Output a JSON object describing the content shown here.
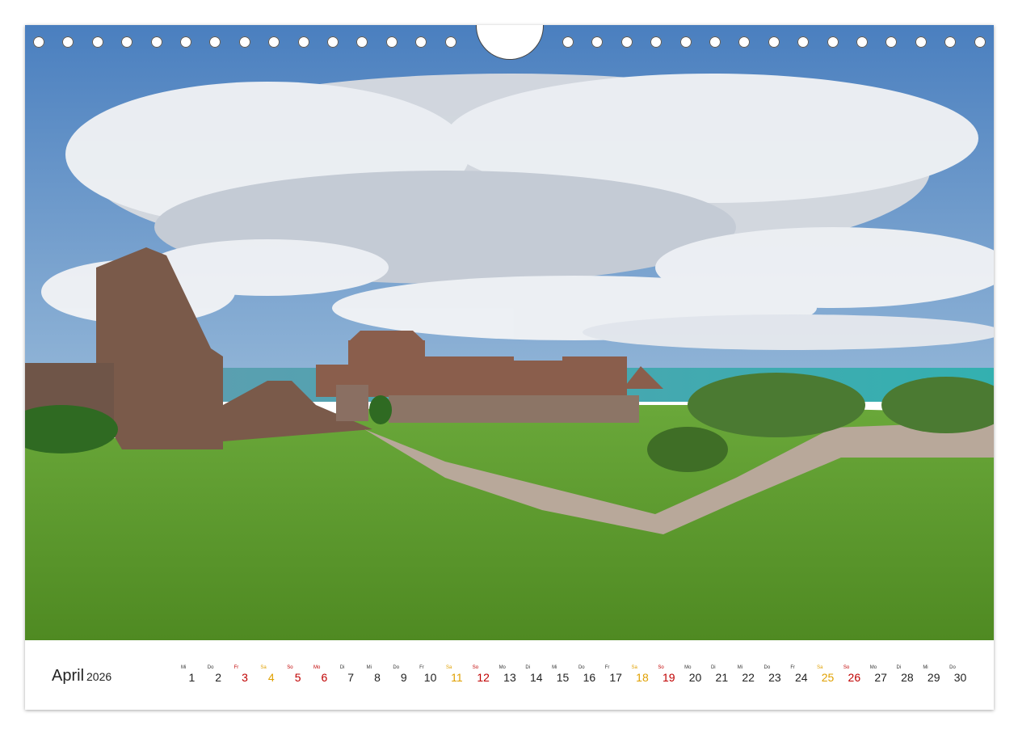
{
  "calendar": {
    "month": "April",
    "year": "2026",
    "days": [
      {
        "d": "1",
        "w": "Mi",
        "t": ""
      },
      {
        "d": "2",
        "w": "Do",
        "t": ""
      },
      {
        "d": "3",
        "w": "Fr",
        "t": "hol"
      },
      {
        "d": "4",
        "w": "Sa",
        "t": "sat"
      },
      {
        "d": "5",
        "w": "So",
        "t": "sun"
      },
      {
        "d": "6",
        "w": "Mo",
        "t": "hol"
      },
      {
        "d": "7",
        "w": "Di",
        "t": ""
      },
      {
        "d": "8",
        "w": "Mi",
        "t": ""
      },
      {
        "d": "9",
        "w": "Do",
        "t": ""
      },
      {
        "d": "10",
        "w": "Fr",
        "t": ""
      },
      {
        "d": "11",
        "w": "Sa",
        "t": "sat"
      },
      {
        "d": "12",
        "w": "So",
        "t": "sun"
      },
      {
        "d": "13",
        "w": "Mo",
        "t": ""
      },
      {
        "d": "14",
        "w": "Di",
        "t": ""
      },
      {
        "d": "15",
        "w": "Mi",
        "t": ""
      },
      {
        "d": "16",
        "w": "Do",
        "t": ""
      },
      {
        "d": "17",
        "w": "Fr",
        "t": ""
      },
      {
        "d": "18",
        "w": "Sa",
        "t": "sat"
      },
      {
        "d": "19",
        "w": "So",
        "t": "sun"
      },
      {
        "d": "20",
        "w": "Mo",
        "t": ""
      },
      {
        "d": "21",
        "w": "Di",
        "t": ""
      },
      {
        "d": "22",
        "w": "Mi",
        "t": ""
      },
      {
        "d": "23",
        "w": "Do",
        "t": ""
      },
      {
        "d": "24",
        "w": "Fr",
        "t": ""
      },
      {
        "d": "25",
        "w": "Sa",
        "t": "sat"
      },
      {
        "d": "26",
        "w": "So",
        "t": "sun"
      },
      {
        "d": "27",
        "w": "Mo",
        "t": ""
      },
      {
        "d": "28",
        "w": "Di",
        "t": ""
      },
      {
        "d": "29",
        "w": "Mi",
        "t": ""
      },
      {
        "d": "30",
        "w": "Do",
        "t": ""
      }
    ]
  },
  "colors": {
    "saturday": "#e0a000",
    "sunday_holiday": "#c00000",
    "sky": "#3f78b8",
    "grass": "#5e9a2c",
    "stone": "#7a5a4a",
    "sea": "#3fa8a8"
  },
  "binding": {
    "hole_count_left": 15,
    "hole_count_right": 15
  }
}
